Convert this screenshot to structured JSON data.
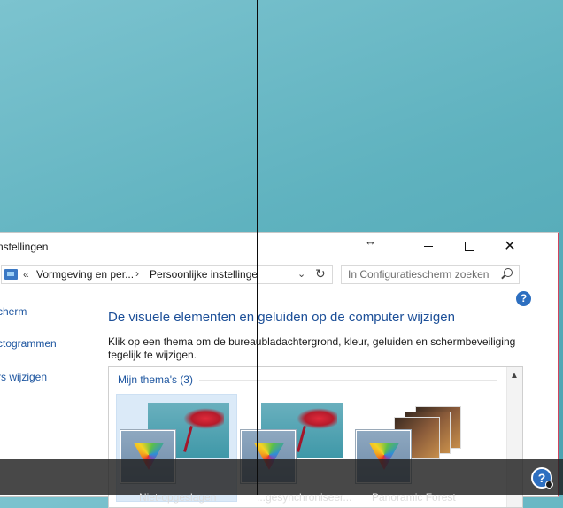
{
  "window": {
    "title": "nstellingen",
    "address": {
      "overflow_arrows": "«",
      "crumb1": "Vormgeving en per...",
      "separator": "›",
      "crumb2": "Persoonlijke instellinge"
    },
    "search_placeholder": "In Configuratiescherm zoeken",
    "help": "?"
  },
  "sidebar": {
    "links": [
      "cherm",
      "ctogrammen",
      "rs wijzigen"
    ]
  },
  "main": {
    "heading": "De visuele elementen en geluiden op de computer wijzigen",
    "description": "Klik op een thema om de bureaubladachtergrond, kleur, geluiden en schermbeveiliging tegelijk te wijzigen.",
    "themes_header": "Mijn thema's (3)",
    "theme_labels": [
      "Niet-opgeslagen",
      "...gesynchroniseer...",
      "Panoramic Forest"
    ]
  },
  "colors": {
    "accent": "#1c4f98",
    "link": "#1e56a0",
    "window_border_right": "#d0455f"
  },
  "icons": [
    "address-control-panel-icon",
    "refresh-icon",
    "search-icon",
    "help-icon",
    "minimize-icon",
    "maximize-icon",
    "close-icon",
    "resize-cursor-icon"
  ]
}
